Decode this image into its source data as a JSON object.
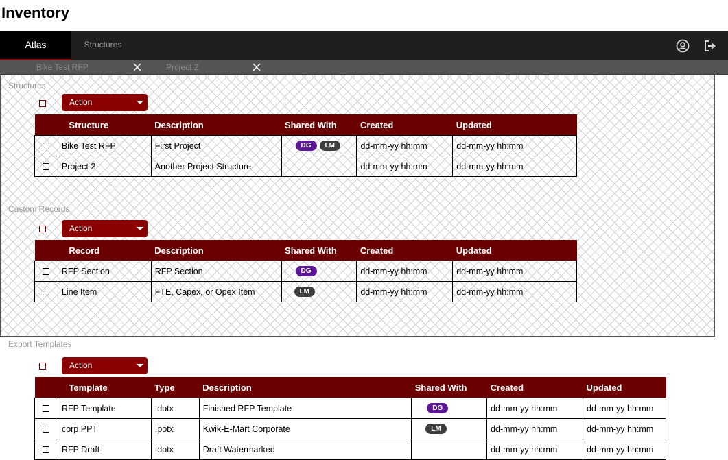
{
  "page_title": "Inventory",
  "nav": {
    "tabs": [
      {
        "label": "Atlas",
        "active": true
      },
      {
        "label": "Structures",
        "active": false
      }
    ],
    "icons": [
      "user-icon",
      "logout-icon"
    ]
  },
  "open_tabs": [
    {
      "label": "Bike Test RFP"
    },
    {
      "label": "Project 2"
    }
  ],
  "colors": {
    "header": "#6b0000",
    "button": "#8b0000",
    "badge_dg": "#5b1795",
    "badge_lm": "#3d3d3d"
  },
  "structures": {
    "label": "Structures",
    "action_label": "Action",
    "columns": [
      "Structure",
      "Description",
      "Shared With",
      "Created",
      "Updated"
    ],
    "rows": [
      {
        "name": "Bike Test RFP",
        "description": "First Project",
        "shared": [
          "DG",
          "LM"
        ],
        "created": "dd-mm-yy hh:mm",
        "updated": "dd-mm-yy hh:mm"
      },
      {
        "name": "Project 2",
        "description": "Another Project Structure",
        "shared": [],
        "created": "dd-mm-yy hh:mm",
        "updated": "dd-mm-yy hh:mm"
      }
    ]
  },
  "custom_records": {
    "label": "Custom Records",
    "action_label": "Action",
    "columns": [
      "Record",
      "Description",
      "Shared With",
      "Created",
      "Updated"
    ],
    "rows": [
      {
        "name": "RFP Section",
        "description": "RFP Section",
        "shared": [
          "DG"
        ],
        "created": "dd-mm-yy hh:mm",
        "updated": "dd-mm-yy hh:mm"
      },
      {
        "name": "Line Item",
        "description": "FTE, Capex, or Opex Item",
        "shared": [
          "LM"
        ],
        "created": "dd-mm-yy hh:mm",
        "updated": "dd-mm-yy hh:mm"
      }
    ]
  },
  "export_templates": {
    "label": "Export Templates",
    "action_label": "Action",
    "columns": [
      "Template",
      "Type",
      "Description",
      "Shared With",
      "Created",
      "Updated"
    ],
    "rows": [
      {
        "name": "RFP Template",
        "type": ".dotx",
        "description": "Finished RFP Template",
        "shared": [
          "DG"
        ],
        "created": "dd-mm-yy hh:mm",
        "updated": "dd-mm-yy hh:mm"
      },
      {
        "name": "corp PPT",
        "type": ".potx",
        "description": "Kwik-E-Mart Corporate",
        "shared": [
          "LM"
        ],
        "created": "dd-mm-yy hh:mm",
        "updated": "dd-mm-yy hh:mm"
      },
      {
        "name": "RFP Draft",
        "type": ".dotx",
        "description": "Draft Watermarked",
        "shared": [],
        "created": "dd-mm-yy hh:mm",
        "updated": "dd-mm-yy hh:mm"
      }
    ]
  }
}
